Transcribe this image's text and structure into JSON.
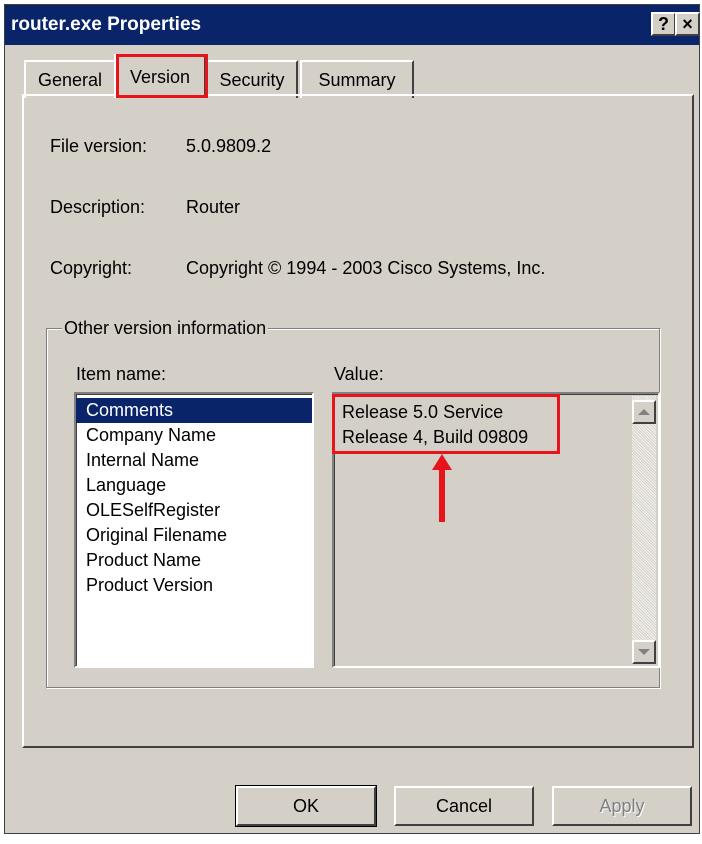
{
  "window": {
    "title": "router.exe Properties",
    "help_glyph": "?",
    "close_glyph": "×"
  },
  "tabs": [
    {
      "label": "General"
    },
    {
      "label": "Version"
    },
    {
      "label": "Security"
    },
    {
      "label": "Summary"
    }
  ],
  "version": {
    "file_version_label": "File version:",
    "file_version_value": "5.0.9809.2",
    "description_label": "Description:",
    "description_value": "Router",
    "copyright_label": "Copyright:",
    "copyright_value": "Copyright © 1994 - 2003 Cisco Systems, Inc."
  },
  "other_info": {
    "group_label": "Other version information",
    "item_name_label": "Item name:",
    "value_label": "Value:",
    "items": [
      "Comments",
      "Company Name",
      "Internal Name",
      "Language",
      "OLESelfRegister",
      "Original Filename",
      "Product Name",
      "Product Version"
    ],
    "selected_item": "Comments",
    "value_lines": [
      "Release 5.0 Service",
      "Release 4, Build 09809"
    ]
  },
  "buttons": {
    "ok": "OK",
    "cancel": "Cancel",
    "apply": "Apply"
  },
  "colors": {
    "titlebar": "#0a246a",
    "face": "#d4d0c8",
    "annotation": "#e8141c"
  }
}
